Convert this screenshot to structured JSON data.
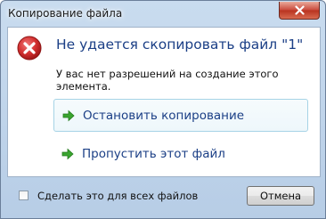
{
  "window": {
    "title": "Копирование файла"
  },
  "dialog": {
    "heading": "Не удается скопировать файл \"1\"",
    "message": "У вас нет разрешений на создание этого элемента.",
    "options": [
      {
        "label": "Остановить копирование",
        "icon": "green-arrow-icon"
      },
      {
        "label": "Пропустить этот файл",
        "icon": "green-arrow-icon"
      }
    ]
  },
  "footer": {
    "apply_all_label": "Сделать это для всех файлов",
    "apply_all_checked": false,
    "cancel_label": "Отмена"
  },
  "colors": {
    "heading": "#1b3f86",
    "arrow": "#3aa52f",
    "error": "#c8262c"
  }
}
